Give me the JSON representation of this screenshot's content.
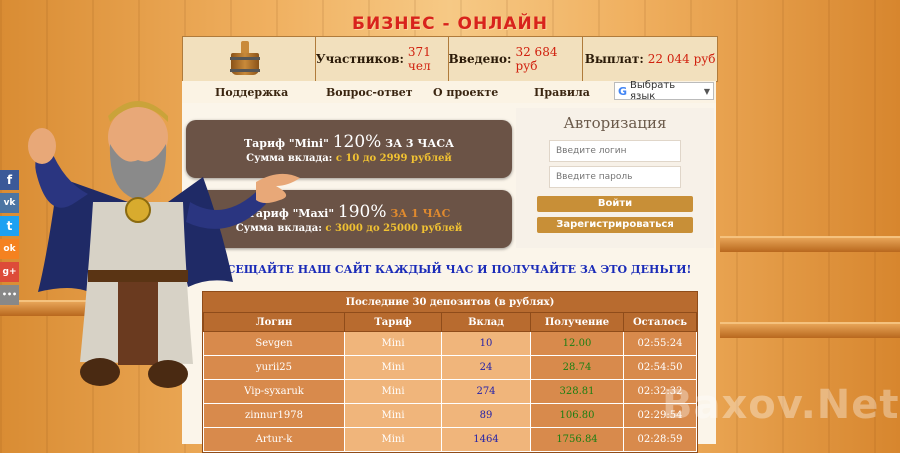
{
  "site": {
    "title": "БИЗНЕС - ОНЛАЙН"
  },
  "stats": {
    "participants_label": "Участников:",
    "participants_value": "371 чел",
    "deposited_label": "Введено:",
    "deposited_value": "32 684 руб",
    "paid_label": "Выплат:",
    "paid_value": "22 044 руб"
  },
  "nav": {
    "items": [
      "Поддержка",
      "Вопрос-ответ",
      "О проекте",
      "Правила"
    ],
    "language_label": "Выбрать язык"
  },
  "tariffs": [
    {
      "name": "Тариф \"Mini\"",
      "percent": "120%",
      "period": "ЗА 3 ЧАСА",
      "sum_label": "Сумма вклада:",
      "range": "с 10 до 2999 рублей"
    },
    {
      "name": "Тариф \"Maxi\"",
      "percent": "190%",
      "period": "ЗА 1 ЧАС",
      "sum_label": "Сумма вклада:",
      "range": "с 3000 до 25000 рублей"
    }
  ],
  "auth": {
    "title": "Авторизация",
    "login_placeholder": "Введите логин",
    "password_placeholder": "Введите пароль",
    "login_button": "Войти",
    "register_button": "Зарегистрироваться"
  },
  "promo": "ПОСЕЩАЙТЕ НАШ САЙТ КАЖДЫЙ ЧАС И ПОЛУЧАЙТЕ ЗА ЭТО ДЕНЬГИ!",
  "deposits": {
    "caption": "Последние 30 депозитов (в рублях)",
    "headers": [
      "Логин",
      "Тариф",
      "Вклад",
      "Получение",
      "Осталось"
    ],
    "rows": [
      [
        "Sevgen",
        "Mini",
        "10",
        "12.00",
        "02:55:24"
      ],
      [
        "yurii25",
        "Mini",
        "24",
        "28.74",
        "02:54:50"
      ],
      [
        "Vip-syxaruk",
        "Mini",
        "274",
        "328.81",
        "02:32:32"
      ],
      [
        "zinnur1978",
        "Mini",
        "89",
        "106.80",
        "02:29:54"
      ],
      [
        "Artur-k",
        "Mini",
        "1464",
        "1756.84",
        "02:28:59"
      ]
    ]
  },
  "social": [
    {
      "name": "facebook-icon",
      "glyph": "f",
      "color": "#3b5998"
    },
    {
      "name": "vk-icon",
      "glyph": "vk",
      "color": "#4c75a3"
    },
    {
      "name": "twitter-icon",
      "glyph": "t",
      "color": "#1da1f2"
    },
    {
      "name": "odnoklassniki-icon",
      "glyph": "ok",
      "color": "#f58220"
    },
    {
      "name": "google-plus-icon",
      "glyph": "g+",
      "color": "#dd4b39"
    },
    {
      "name": "more-icon",
      "glyph": "•••",
      "color": "#888888"
    }
  ],
  "watermark": "Baxov.Net"
}
